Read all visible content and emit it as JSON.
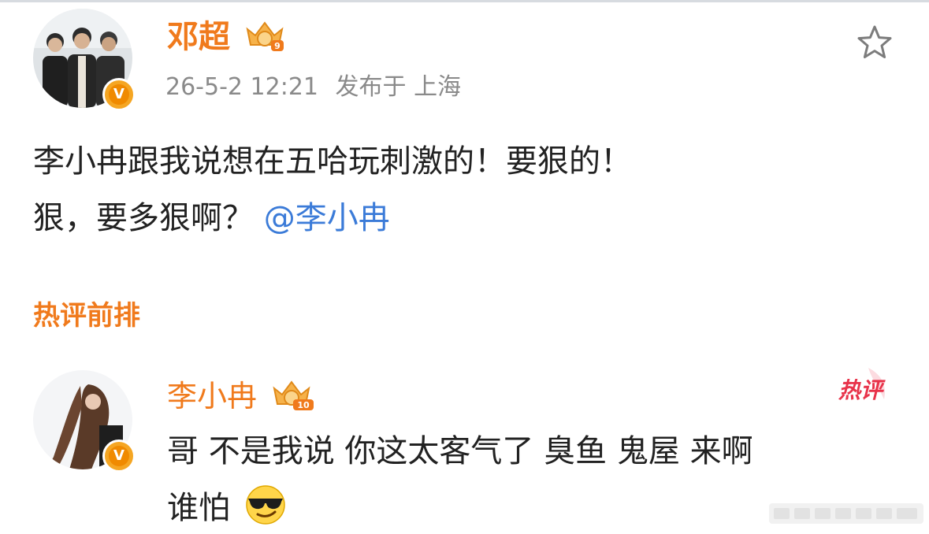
{
  "post": {
    "author_name": "邓超",
    "author_level": "9",
    "timestamp": "26-5-2 12:21",
    "location_label": "发布于 上海",
    "text_line1": "李小冉跟我说想在五哈玩刺激的！要狠的！",
    "text_line2_prefix": "狠，要多狠啊？",
    "mention": "@李小冉",
    "favorite_icon": "star-outline-icon",
    "verified_mark": "V"
  },
  "hot_comments": {
    "section_title": "热评前排",
    "items": [
      {
        "author_name": "李小冉",
        "author_level": "10",
        "tag": "热评",
        "text_line1": "哥 不是我说 你这太客气了 臭鱼 鬼屋 来啊",
        "text_line2": "谁怕",
        "emoji": "sunglasses-smirk-emoji",
        "verified_mark": "V"
      }
    ]
  },
  "colors": {
    "accent_orange": "#f07a1c",
    "mention_blue": "#3b7bd8",
    "meta_gray": "#8a8a8a",
    "hot_tag_red": "#e8334a"
  }
}
